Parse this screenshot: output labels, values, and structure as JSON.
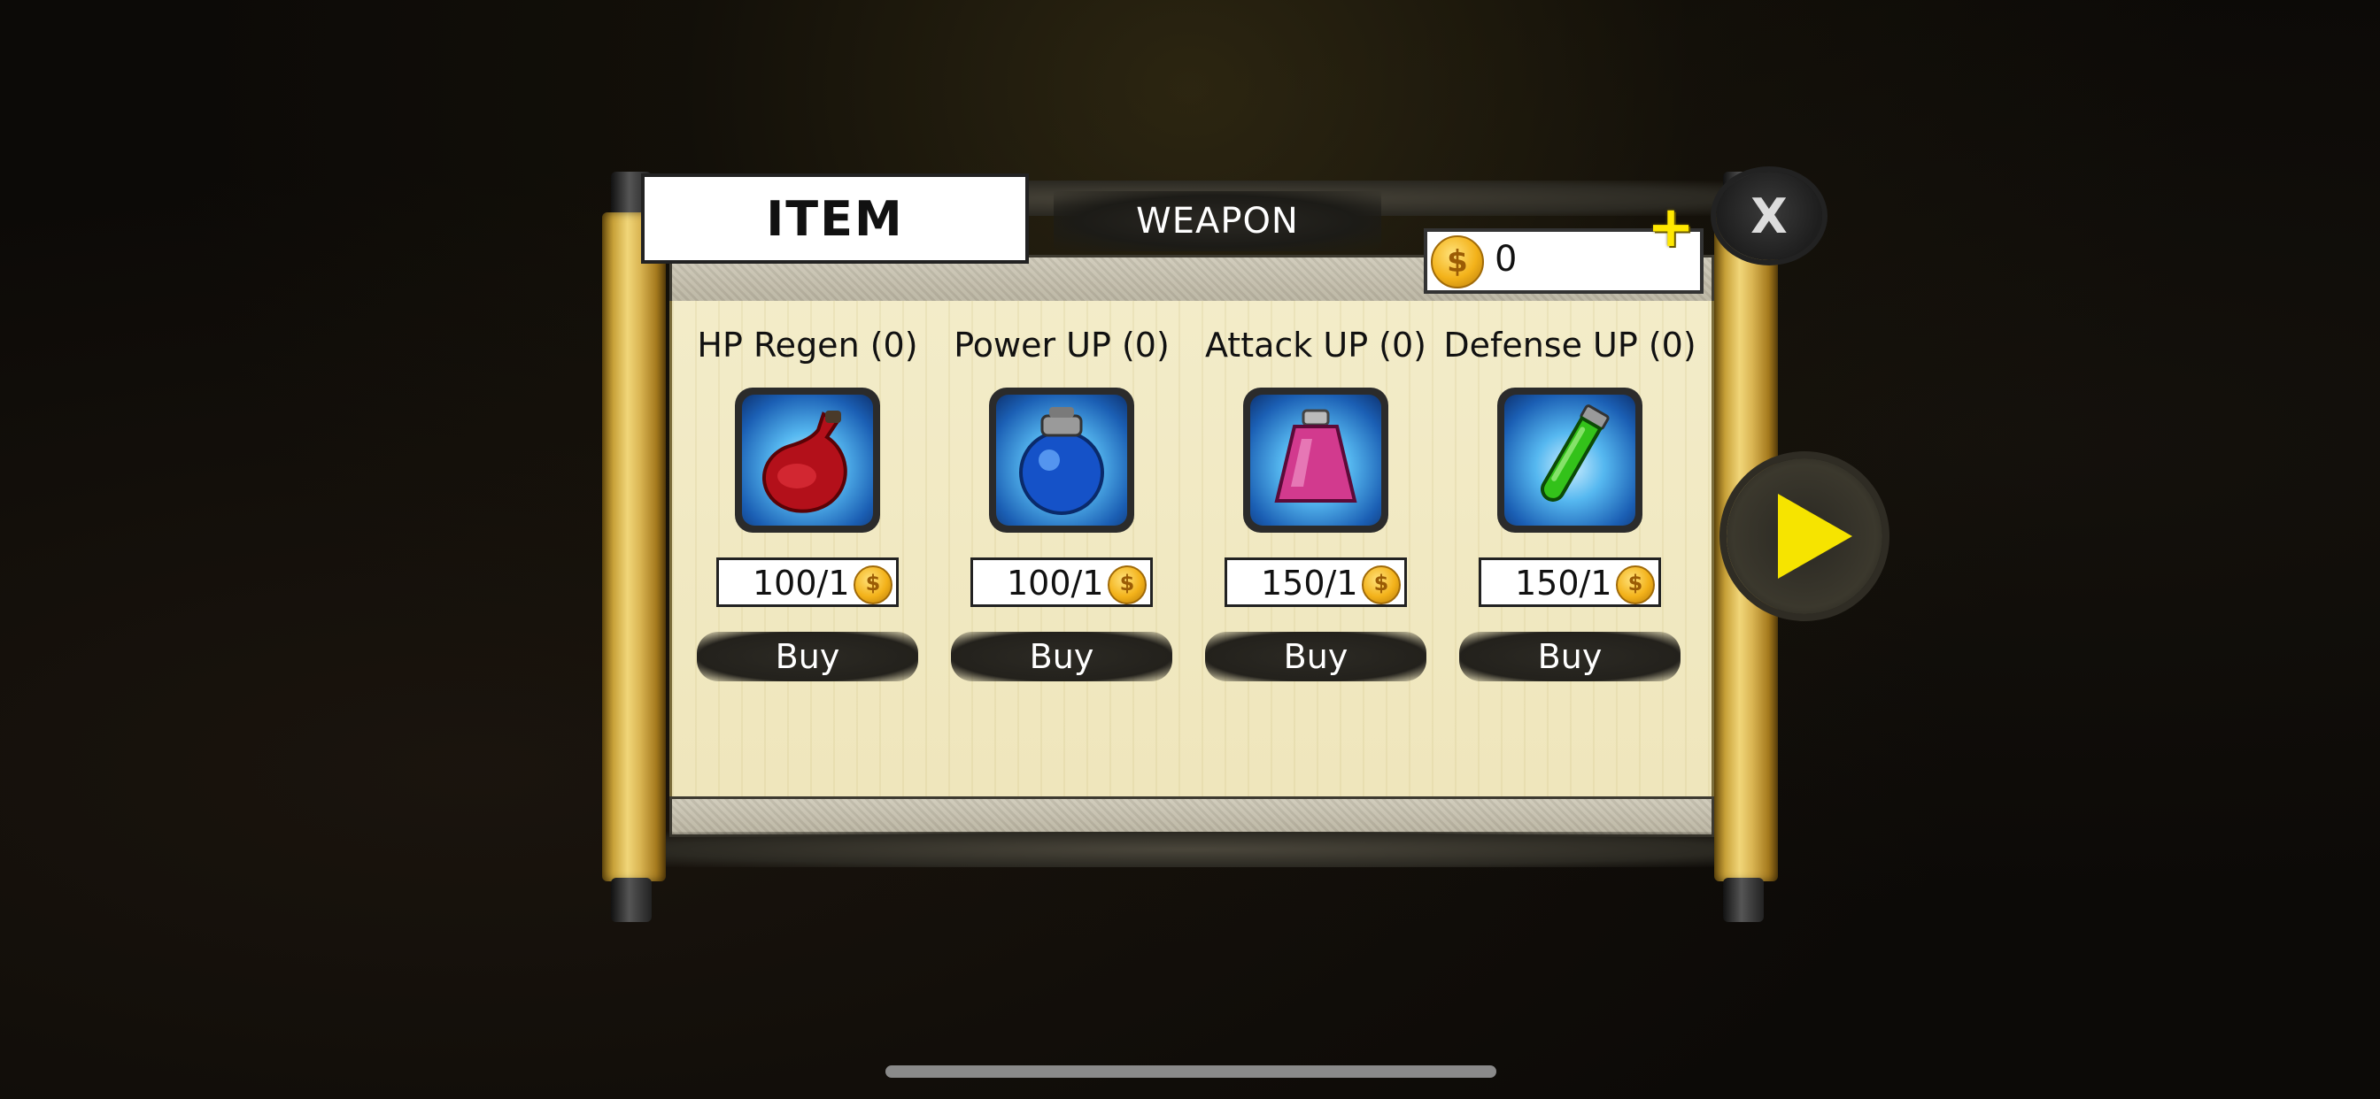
{
  "tabs": {
    "item_label": "ITEM",
    "weapon_label": "WEAPON"
  },
  "currency": {
    "value": "0",
    "plus_label": "+"
  },
  "close_label": "X",
  "items": [
    {
      "name": "HP Regen (0)",
      "price": "100/1",
      "buy_label": "Buy",
      "icon": "red-potion-icon",
      "color": "#c0141e"
    },
    {
      "name": "Power UP (0)",
      "price": "100/1",
      "buy_label": "Buy",
      "icon": "blue-potion-icon",
      "color": "#1a5fd0"
    },
    {
      "name": "Attack UP (0)",
      "price": "150/1",
      "buy_label": "Buy",
      "icon": "pink-potion-icon",
      "color": "#d63a8c"
    },
    {
      "name": "Defense UP (0)",
      "price": "150/1",
      "buy_label": "Buy",
      "icon": "green-potion-icon",
      "color": "#38c018"
    }
  ],
  "colors": {
    "accent_yellow": "#f6e400",
    "scroll_gold": "#d9b452",
    "paper": "#f1e9c2"
  }
}
